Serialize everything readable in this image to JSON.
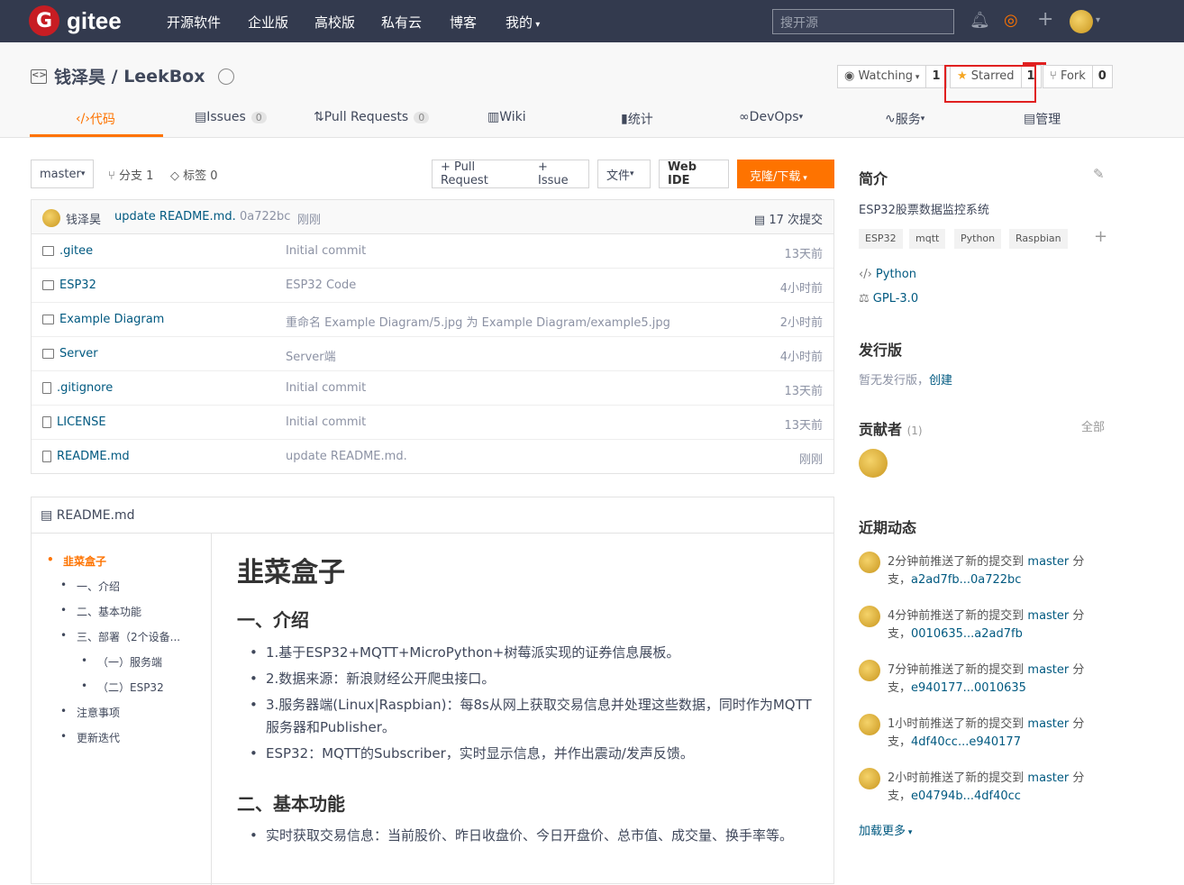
{
  "topnav": {
    "logo_letter": "G",
    "logo_text": "gitee",
    "items": [
      "开源软件",
      "企业版",
      "高校版",
      "私有云",
      "博客",
      "我的"
    ],
    "search_placeholder": "搜开源"
  },
  "repo": {
    "owner": "钱泽昊",
    "separator": " / ",
    "name": "LeekBox"
  },
  "actions": {
    "watching": "Watching",
    "watching_count": "1",
    "starred": "Starred",
    "starred_count": "1",
    "fork": "Fork",
    "fork_count": "0"
  },
  "tabs": [
    {
      "label": "代码"
    },
    {
      "label": "Issues",
      "count": "0"
    },
    {
      "label": "Pull Requests",
      "count": "0"
    },
    {
      "label": "Wiki"
    },
    {
      "label": "统计"
    },
    {
      "label": "DevOps"
    },
    {
      "label": "服务"
    },
    {
      "label": "管理"
    }
  ],
  "toolbar": {
    "branch": "master",
    "branches": "分支 1",
    "tags": "标签 0",
    "pull_request": "+ Pull Request",
    "issue": "+ Issue",
    "files": "文件",
    "webide": "Web IDE",
    "clone": "克隆/下载"
  },
  "commit": {
    "author": "钱泽昊",
    "message": "update README.md.",
    "hash": "0a722bc",
    "time": "刚刚",
    "count": "17 次提交"
  },
  "files": [
    {
      "name": ".gitee",
      "type": "dir",
      "message": "Initial commit",
      "time": "13天前"
    },
    {
      "name": "ESP32",
      "type": "dir",
      "message": "ESP32 Code",
      "time": "4小时前"
    },
    {
      "name": "Example Diagram",
      "type": "dir",
      "message": "重命名 Example Diagram/5.jpg 为 Example Diagram/example5.jpg",
      "time": "2小时前"
    },
    {
      "name": "Server",
      "type": "dir",
      "message": "Server端",
      "time": "4小时前"
    },
    {
      "name": ".gitignore",
      "type": "file",
      "message": "Initial commit",
      "time": "13天前"
    },
    {
      "name": "LICENSE",
      "type": "file",
      "message": "Initial commit",
      "time": "13天前"
    },
    {
      "name": "README.md",
      "type": "file",
      "message": "update README.md.",
      "time": "刚刚"
    }
  ],
  "readme": {
    "title": "README.md",
    "toc": [
      "韭菜盒子",
      "一、介绍",
      "二、基本功能",
      "三、部署（2个设备...",
      "（一）服务端",
      "（二）ESP32",
      "注意事项",
      "更新迭代"
    ],
    "h1": "韭菜盒子",
    "h2_intro": "一、介绍",
    "intro_items": [
      "1.基于ESP32+MQTT+MicroPython+树莓派实现的证券信息展板。",
      "2.数据来源：新浪财经公开爬虫接口。",
      "3.服务器端(Linux|Raspbian)：每8s从网上获取交易信息并处理这些数据，同时作为MQTT服务器和Publisher。",
      "ESP32：MQTT的Subscriber，实时显示信息，并作出震动/发声反馈。"
    ],
    "h2_features": "二、基本功能",
    "feature_items": [
      "实时获取交易信息：当前股价、昨日收盘价、今日开盘价、总市值、成交量、换手率等。"
    ]
  },
  "sidebar": {
    "intro_title": "简介",
    "description": "ESP32股票数据监控系统",
    "tags": [
      "ESP32",
      "mqtt",
      "Python",
      "Raspbian"
    ],
    "language": "Python",
    "license": "GPL-3.0",
    "release_title": "发行版",
    "release_text": "暂无发行版，",
    "release_link": "创建",
    "contrib_title": "贡献者",
    "contrib_count": "(1)",
    "contrib_all": "全部",
    "activity_title": "近期动态",
    "activities": [
      {
        "prefix": "2分钟前推送了新的提交到 ",
        "branch": "master",
        "suffix": " 分支，",
        "range": "a2ad7fb...0a722bc"
      },
      {
        "prefix": "4分钟前推送了新的提交到 ",
        "branch": "master",
        "suffix": " 分支，",
        "range": "0010635...a2ad7fb"
      },
      {
        "prefix": "7分钟前推送了新的提交到 ",
        "branch": "master",
        "suffix": " 分支，",
        "range": "e940177...0010635"
      },
      {
        "prefix": "1小时前推送了新的提交到 ",
        "branch": "master",
        "suffix": " 分支，",
        "range": "4df40cc...e940177"
      },
      {
        "prefix": "2小时前推送了新的提交到 ",
        "branch": "master",
        "suffix": " 分支，",
        "range": "e04794b...4df40cc"
      }
    ],
    "load_more": "加载更多"
  }
}
